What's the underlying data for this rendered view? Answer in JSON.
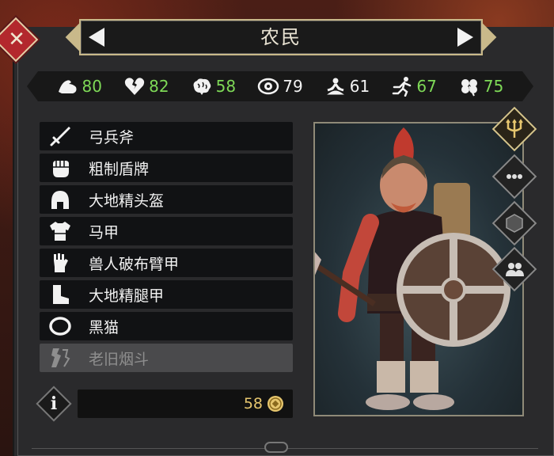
{
  "title": "农民",
  "colors": {
    "stat_value_green": "#7ed957",
    "stat_value_white": "#f2f2f2",
    "gold": "#e6c66e",
    "close_red": "#b3282d",
    "frame_gold": "#c9b98a"
  },
  "stats": [
    {
      "icon": "strength-arm-icon",
      "value": "80",
      "color": "#7ed957"
    },
    {
      "icon": "broken-heart-icon",
      "value": "82",
      "color": "#7ed957"
    },
    {
      "icon": "brain-icon",
      "value": "58",
      "color": "#7ed957"
    },
    {
      "icon": "eye-icon",
      "value": "79",
      "color": "#f2f2f2"
    },
    {
      "icon": "meditation-icon",
      "value": "61",
      "color": "#f2f2f2"
    },
    {
      "icon": "running-figure-icon",
      "value": "67",
      "color": "#7ed957"
    },
    {
      "icon": "clover-icon",
      "value": "75",
      "color": "#7ed957"
    }
  ],
  "equipment": [
    {
      "slot": "sword-icon",
      "label": "弓兵斧",
      "enabled": true
    },
    {
      "slot": "fist-icon",
      "label": "粗制盾牌",
      "enabled": true
    },
    {
      "slot": "helmet-icon",
      "label": "大地精头盔",
      "enabled": true
    },
    {
      "slot": "chest-armor-icon",
      "label": "马甲",
      "enabled": true
    },
    {
      "slot": "gauntlet-icon",
      "label": "兽人破布臂甲",
      "enabled": true
    },
    {
      "slot": "boot-icon",
      "label": "大地精腿甲",
      "enabled": true
    },
    {
      "slot": "ring-icon",
      "label": "黑猫",
      "enabled": true
    },
    {
      "slot": "trinket-icon",
      "label": "老旧烟斗",
      "enabled": false
    }
  ],
  "gold": "58",
  "side_buttons": [
    {
      "icon": "trident-icon",
      "active": true
    },
    {
      "icon": "more-dots-icon",
      "active": false
    },
    {
      "icon": "hexagon-icon",
      "active": false
    },
    {
      "icon": "group-icon",
      "active": false
    }
  ]
}
